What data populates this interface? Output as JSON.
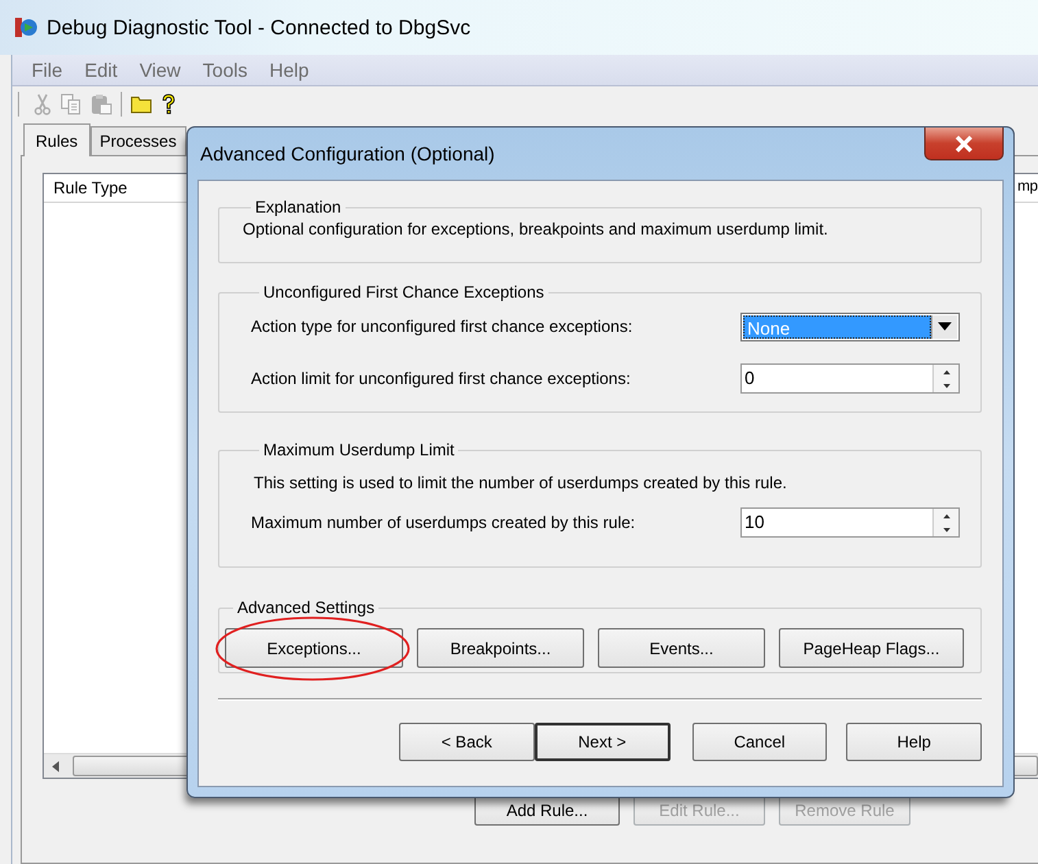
{
  "window": {
    "title": "Debug Diagnostic Tool - Connected to DbgSvc"
  },
  "menu": [
    "File",
    "Edit",
    "View",
    "Tools",
    "Help"
  ],
  "toolbar": [
    {
      "kind": "cut",
      "disabled": true
    },
    {
      "kind": "copy",
      "disabled": true
    },
    {
      "kind": "paste",
      "disabled": true
    },
    {
      "kind": "folder",
      "disabled": false
    },
    {
      "kind": "help",
      "disabled": false
    }
  ],
  "tabs": [
    {
      "label": "Rules",
      "selected": true
    },
    {
      "label": "Processes",
      "selected": false
    }
  ],
  "rules_list": {
    "columns": [
      "Rule Type",
      "mp"
    ]
  },
  "buttons": [
    {
      "label": "Add Rule...",
      "disabled": false
    },
    {
      "label": "Edit Rule...",
      "disabled": true
    },
    {
      "label": "Remove Rule",
      "disabled": true
    }
  ],
  "dialog": {
    "title": "Advanced Configuration (Optional)",
    "groups": [
      {
        "title": "Explanation",
        "text": "Optional configuration for exceptions, breakpoints and maximum userdump limit."
      },
      {
        "title": "Unconfigured First Chance Exceptions",
        "fields": [
          {
            "kind": "dropdown",
            "label": "Action type for unconfigured first chance exceptions:",
            "value": "None"
          },
          {
            "kind": "spinner",
            "label": "Action limit for unconfigured first chance exceptions:",
            "value": "0"
          }
        ]
      },
      {
        "title": "Maximum Userdump Limit",
        "text": "This setting is used to limit the number of userdumps created by this rule.",
        "fields": [
          {
            "kind": "spinner",
            "label": "Maximum number of userdumps created by this rule:",
            "value": "10"
          }
        ]
      },
      {
        "title": "Advanced Settings",
        "buttons": [
          {
            "label": "Exceptions...",
            "circled": true
          },
          {
            "label": "Breakpoints...",
            "circled": false
          },
          {
            "label": "Events...",
            "circled": false
          },
          {
            "label": "PageHeap Flags...",
            "circled": false
          }
        ]
      }
    ],
    "nav_buttons": [
      {
        "label": "< Back",
        "default": false
      },
      {
        "label": "Next >",
        "default": true
      },
      {
        "label": "Cancel",
        "default": false
      },
      {
        "label": "Help",
        "default": false
      }
    ]
  }
}
